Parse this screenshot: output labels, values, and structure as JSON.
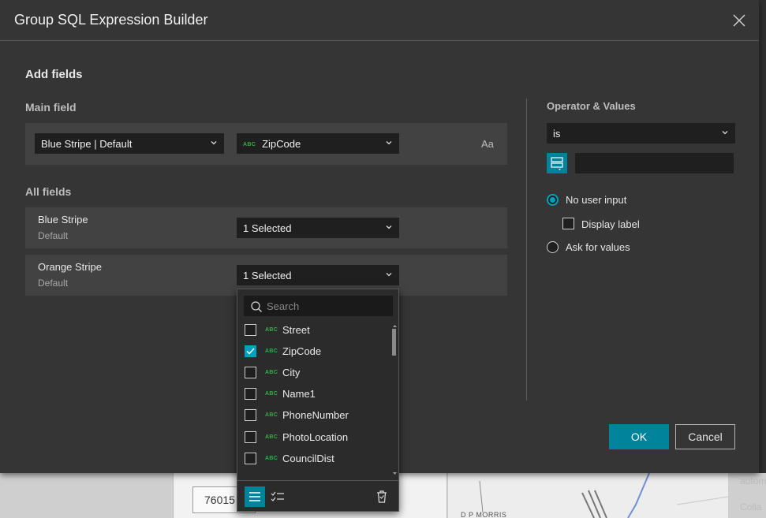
{
  "dialog": {
    "title": "Group SQL Expression Builder",
    "add_fields": "Add fields",
    "main_field_label": "Main field",
    "main_field": {
      "layer_select": "Blue Stripe | Default",
      "field_select": "ZipCode",
      "case_toggle": "Aa"
    },
    "all_fields_label": "All fields",
    "rows": [
      {
        "name": "Blue Stripe",
        "sub": "Default",
        "select": "1 Selected"
      },
      {
        "name": "Orange Stripe",
        "sub": "Default",
        "select": "1 Selected"
      }
    ],
    "operator": {
      "label": "Operator & Values",
      "value": "is",
      "options": [
        {
          "label": "No user input",
          "selected": true
        },
        {
          "label": "Display label",
          "checked": false
        },
        {
          "label": "Ask for values",
          "selected": false
        }
      ]
    },
    "ok_label": "OK",
    "cancel_label": "Cancel"
  },
  "dropdown": {
    "search_placeholder": "Search",
    "type_badge": "ABC",
    "items": [
      {
        "name": "Street",
        "checked": false
      },
      {
        "name": "ZipCode",
        "checked": true
      },
      {
        "name": "City",
        "checked": false
      },
      {
        "name": "Name1",
        "checked": false
      },
      {
        "name": "PhoneNumber",
        "checked": false
      },
      {
        "name": "PhotoLocation",
        "checked": false
      },
      {
        "name": "CouncilDist",
        "checked": false
      }
    ]
  },
  "background": {
    "input_value": "76015",
    "map_label": "D P MORRIS",
    "side_text_1": "autom",
    "side_text_2": "Colla"
  },
  "colors": {
    "accent": "#00839b",
    "accent_light": "#00a2bd",
    "field_type": "#35ac46",
    "dialog_bg": "#353535"
  }
}
